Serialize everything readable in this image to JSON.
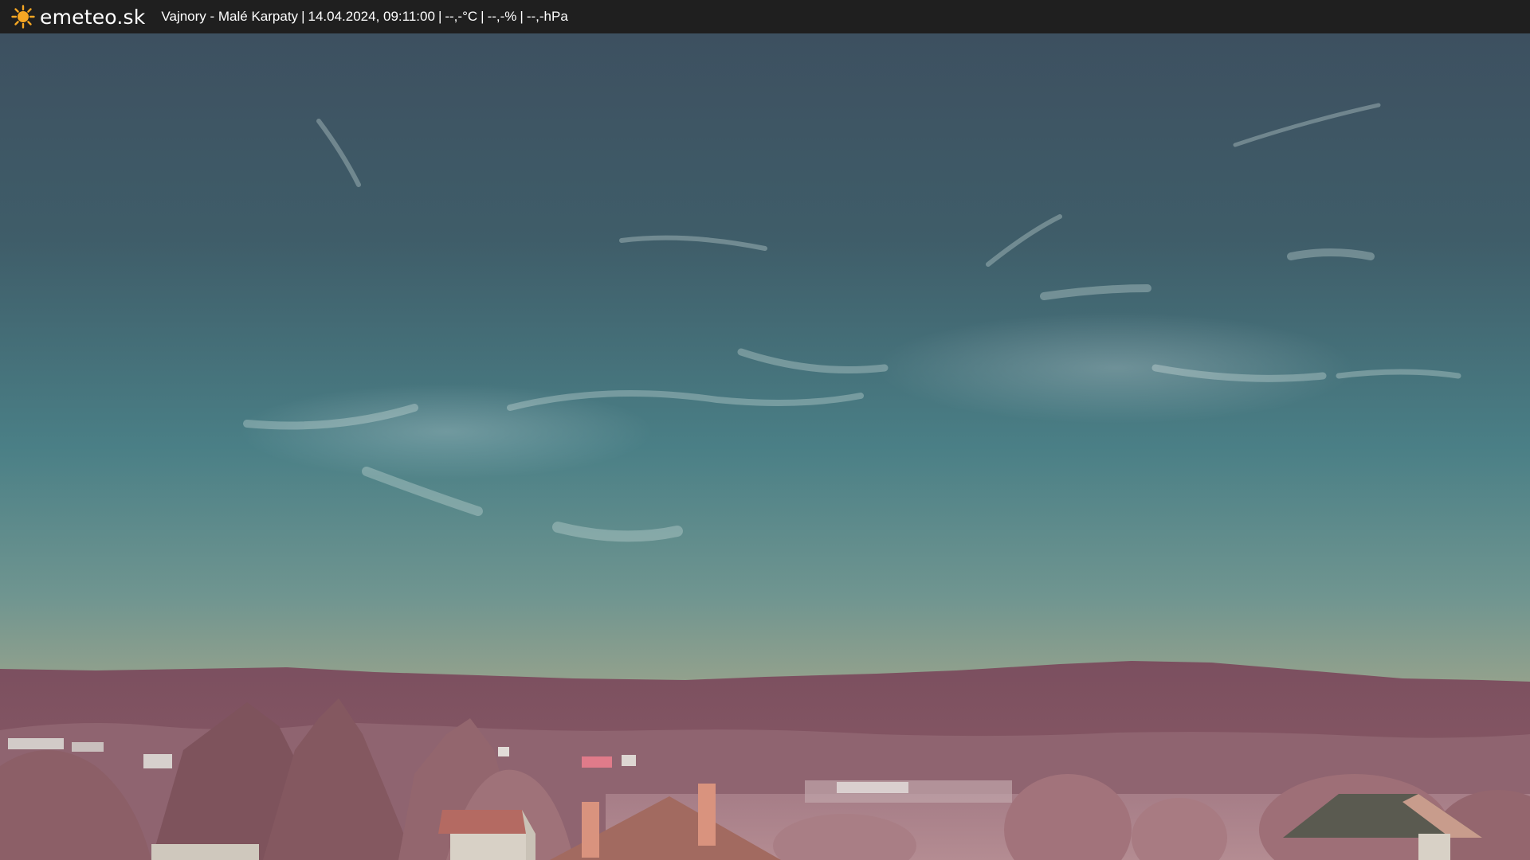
{
  "header": {
    "brand_icon": "sun-icon",
    "brand_name": "emeteo.sk",
    "location": "Vajnory - Malé Karpaty",
    "datetime": "14.04.2024, 09:11:00",
    "temperature": "--,-°C",
    "humidity": "--,-%",
    "pressure": "--,-hPa",
    "separator": "|"
  },
  "colors": {
    "bar_background": "#1f1f1f",
    "sun": "#f5a623",
    "sky_top": "#3e5563",
    "sky_mid": "#4a8088",
    "sky_horizon": "#a3a488",
    "hills": "#7a4f5e",
    "foliage": "#9b6b72"
  }
}
